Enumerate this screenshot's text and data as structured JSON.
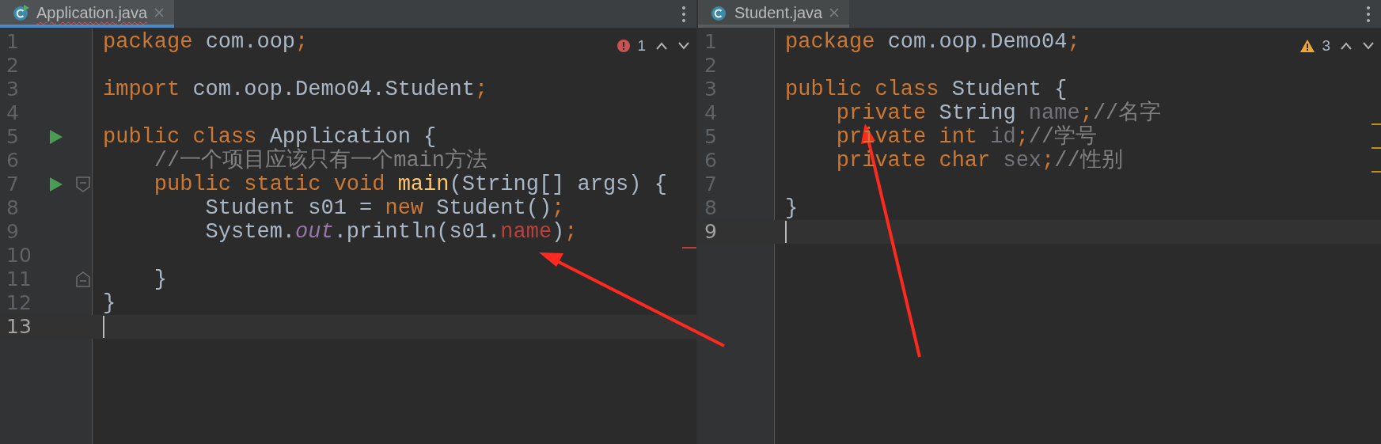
{
  "editors": [
    {
      "tab": {
        "title": "Application.java",
        "selected": true,
        "error": true,
        "runnable": true
      },
      "inspection": {
        "kind": "error",
        "count": "1"
      },
      "lines": [
        {
          "number": "1",
          "tokens": [
            {
              "kind": "keyword",
              "text": "package "
            },
            {
              "kind": "plain",
              "text": "com.oop"
            },
            {
              "kind": "keyword",
              "text": ";"
            }
          ]
        },
        {
          "number": "2"
        },
        {
          "number": "3",
          "tokens": [
            {
              "kind": "keyword",
              "text": "import "
            },
            {
              "kind": "plain",
              "text": "com.oop.Demo04.Student"
            },
            {
              "kind": "keyword",
              "text": ";"
            }
          ]
        },
        {
          "number": "4"
        },
        {
          "number": "5",
          "run": true,
          "tokens": [
            {
              "kind": "keyword",
              "text": "public class "
            },
            {
              "kind": "plain",
              "text": "Application {"
            }
          ]
        },
        {
          "number": "6",
          "tokens": [
            {
              "kind": "comment",
              "text": "    //一个项目应该只有一个main方法"
            }
          ]
        },
        {
          "number": "7",
          "run": true,
          "fold_open": true,
          "tokens": [
            {
              "kind": "keyword",
              "text": "    public static void "
            },
            {
              "kind": "method",
              "text": "main"
            },
            {
              "kind": "plain",
              "text": "(String[] args) {"
            }
          ]
        },
        {
          "number": "8",
          "tokens": [
            {
              "kind": "plain",
              "text": "        Student s01 = "
            },
            {
              "kind": "keyword",
              "text": "new "
            },
            {
              "kind": "plain",
              "text": "Student()"
            },
            {
              "kind": "keyword",
              "text": ";"
            }
          ]
        },
        {
          "number": "9",
          "tokens": [
            {
              "kind": "plain",
              "text": "        System."
            },
            {
              "kind": "static",
              "text": "out"
            },
            {
              "kind": "plain",
              "text": ".println(s01."
            },
            {
              "kind": "error",
              "text": "name"
            },
            {
              "kind": "plain",
              "text": ")"
            },
            {
              "kind": "keyword",
              "text": ";"
            }
          ]
        },
        {
          "number": "10",
          "error_stripe": true
        },
        {
          "number": "11",
          "fold_close": true,
          "tokens": [
            {
              "kind": "plain",
              "text": "    }"
            }
          ]
        },
        {
          "number": "12",
          "tokens": [
            {
              "kind": "plain",
              "text": "}"
            }
          ]
        },
        {
          "number": "13",
          "current": true
        }
      ]
    },
    {
      "tab": {
        "title": "Student.java",
        "selected": false,
        "error": false,
        "runnable": false
      },
      "inspection": {
        "kind": "warning",
        "count": "3"
      },
      "lines": [
        {
          "number": "1",
          "tokens": [
            {
              "kind": "keyword",
              "text": "package "
            },
            {
              "kind": "plain",
              "text": "com.oop.Demo04"
            },
            {
              "kind": "keyword",
              "text": ";"
            }
          ]
        },
        {
          "number": "2"
        },
        {
          "number": "3",
          "tokens": [
            {
              "kind": "keyword",
              "text": "public class "
            },
            {
              "kind": "plain",
              "text": "Student {"
            }
          ]
        },
        {
          "number": "4",
          "tokens": [
            {
              "kind": "keyword",
              "text": "    private "
            },
            {
              "kind": "plain",
              "text": "String "
            },
            {
              "kind": "unused",
              "text": "name"
            },
            {
              "kind": "keyword",
              "text": ";"
            },
            {
              "kind": "comment",
              "text": "//名字"
            }
          ]
        },
        {
          "number": "5",
          "warning_stripe": true,
          "tokens": [
            {
              "kind": "keyword",
              "text": "    private int "
            },
            {
              "kind": "unused",
              "text": "id"
            },
            {
              "kind": "keyword",
              "text": ";"
            },
            {
              "kind": "comment",
              "text": "//学号"
            }
          ]
        },
        {
          "number": "6",
          "warning_stripe": true,
          "tokens": [
            {
              "kind": "keyword",
              "text": "    private char "
            },
            {
              "kind": "unused",
              "text": "sex"
            },
            {
              "kind": "keyword",
              "text": ";"
            },
            {
              "kind": "comment",
              "text": "//性别"
            }
          ]
        },
        {
          "number": "7",
          "warning_stripe": true
        },
        {
          "number": "8",
          "tokens": [
            {
              "kind": "plain",
              "text": "}"
            }
          ]
        },
        {
          "number": "9",
          "current": true
        }
      ]
    }
  ]
}
